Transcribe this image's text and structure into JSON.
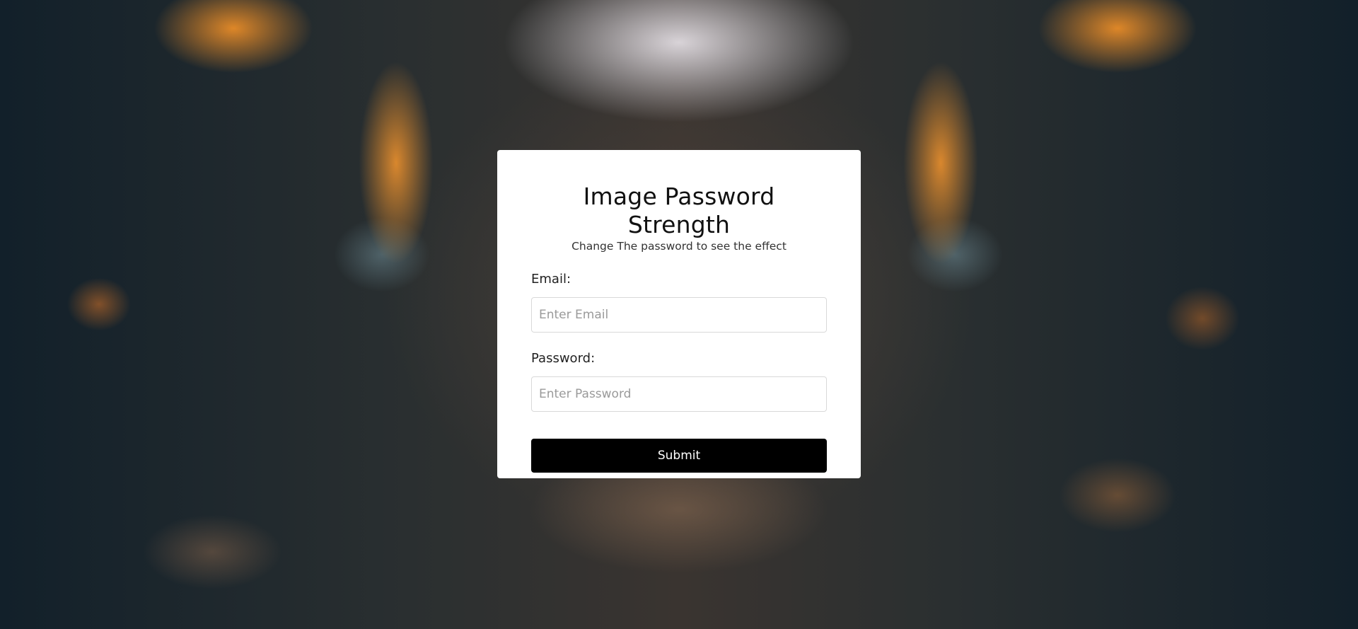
{
  "form": {
    "title": "Image Password Strength",
    "subtitle": "Change The password to see the effect",
    "email_label": "Email:",
    "email_placeholder": "Enter Email",
    "email_value": "",
    "password_label": "Password:",
    "password_placeholder": "Enter Password",
    "password_value": "",
    "submit_label": "Submit"
  },
  "colors": {
    "card_background": "#ffffff",
    "button_background": "#000000",
    "button_text": "#ffffff"
  }
}
